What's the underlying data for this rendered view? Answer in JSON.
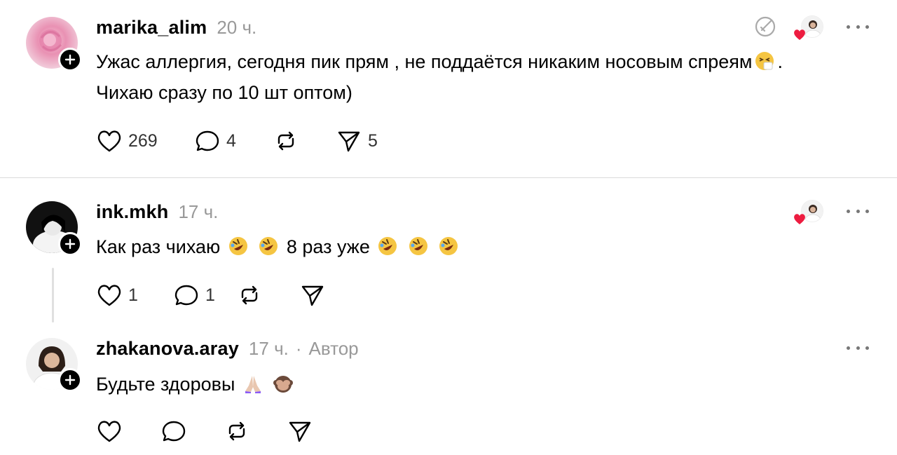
{
  "posts": [
    {
      "username": "marika_alim",
      "time": "20 ч.",
      "text_line1": "Ужас аллергия, сегодня пик прям , не поддаётся никаким носовым спреям",
      "text_line1_end": ".",
      "text_line2": "Чихаю сразу по 10 шт оптом)",
      "likes": "269",
      "comments": "4",
      "shares": "5"
    },
    {
      "username": "ink.mkh",
      "time": "17 ч.",
      "text_part1": "Как раз чихаю",
      "text_part2": "8 раз уже",
      "likes": "1",
      "comments": "1"
    },
    {
      "username": "zhakanova.aray",
      "time": "17 ч.",
      "author_label": "Автор",
      "text": "Будьте здоровы"
    }
  ],
  "icons": {
    "like": "heart-icon",
    "comment": "comment-bubble-icon",
    "repost": "repost-icon",
    "share": "send-icon",
    "follow": "plus-icon",
    "more": "more-dots-icon",
    "no_answer": "edit-circle-icon"
  },
  "colors": {
    "liked_heart": "#ed1c40",
    "muted_text": "#999999",
    "divider": "#dbdbdb"
  }
}
